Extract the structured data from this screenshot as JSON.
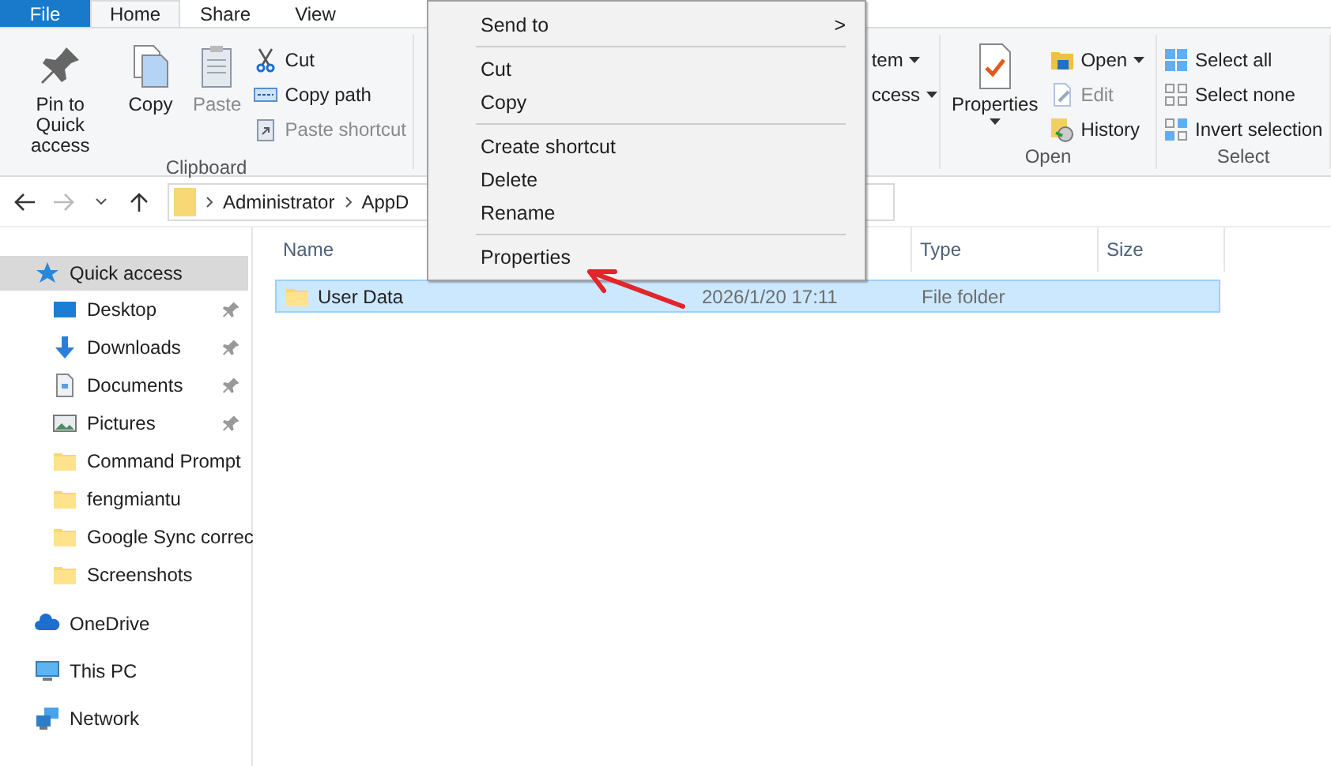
{
  "tabs": [
    {
      "label": "File",
      "kind": "file",
      "selected": false
    },
    {
      "label": "Home",
      "kind": "tab",
      "selected": true
    },
    {
      "label": "Share",
      "kind": "tab",
      "selected": false
    },
    {
      "label": "View",
      "kind": "tab",
      "selected": false
    }
  ],
  "ribbon": {
    "groups": [
      {
        "label": "Clipboard",
        "items": [
          {
            "label": "Pin to Quick access",
            "kind": "large",
            "disabled": false,
            "dropdown": false
          },
          {
            "label": "Copy",
            "kind": "large",
            "disabled": false,
            "dropdown": false
          },
          {
            "label": "Paste",
            "kind": "large",
            "disabled": true,
            "dropdown": false
          },
          {
            "label": "Cut",
            "kind": "small",
            "disabled": false,
            "dropdown": false
          },
          {
            "label": "Copy path",
            "kind": "small",
            "disabled": false,
            "dropdown": false
          },
          {
            "label": "Paste shortcut",
            "kind": "small",
            "disabled": true,
            "dropdown": false
          }
        ]
      },
      {
        "items": [
          {
            "label": "tem",
            "kind": "small",
            "disabled": false,
            "dropdown": true
          },
          {
            "label": "ccess",
            "kind": "small",
            "disabled": false,
            "dropdown": true
          }
        ]
      },
      {
        "label": "Open",
        "items": [
          {
            "label": "Properties",
            "kind": "large",
            "disabled": false,
            "dropdown": true
          },
          {
            "label": "Open",
            "kind": "small",
            "disabled": false,
            "dropdown": true
          },
          {
            "label": "Edit",
            "kind": "small",
            "disabled": true,
            "dropdown": false
          },
          {
            "label": "History",
            "kind": "small",
            "disabled": false,
            "dropdown": false
          }
        ]
      },
      {
        "label": "Select",
        "items": [
          {
            "label": "Select all",
            "kind": "small",
            "disabled": false,
            "dropdown": false
          },
          {
            "label": "Select none",
            "kind": "small",
            "disabled": false,
            "dropdown": false
          },
          {
            "label": "Invert selection",
            "kind": "small",
            "disabled": false,
            "dropdown": false
          }
        ]
      }
    ]
  },
  "navigation": {
    "back_disabled": false,
    "forward_disabled": true,
    "path": [
      "Administrator",
      "AppD"
    ]
  },
  "sidebar": {
    "items": [
      {
        "label": "Quick access",
        "kind": "root",
        "selected": true,
        "pinned": false
      },
      {
        "label": "Desktop",
        "kind": "child",
        "selected": false,
        "pinned": true
      },
      {
        "label": "Downloads",
        "kind": "child",
        "selected": false,
        "pinned": true
      },
      {
        "label": "Documents",
        "kind": "child",
        "selected": false,
        "pinned": true
      },
      {
        "label": "Pictures",
        "kind": "child",
        "selected": false,
        "pinned": true
      },
      {
        "label": "Command Prompt",
        "kind": "child",
        "selected": false,
        "pinned": false
      },
      {
        "label": "fengmiantu",
        "kind": "child",
        "selected": false,
        "pinned": false
      },
      {
        "label": "Google Sync correc",
        "kind": "child",
        "selected": false,
        "pinned": false
      },
      {
        "label": "Screenshots",
        "kind": "child",
        "selected": false,
        "pinned": false
      },
      {
        "label": "OneDrive",
        "kind": "root",
        "selected": false,
        "pinned": false
      },
      {
        "label": "This PC",
        "kind": "root",
        "selected": false,
        "pinned": false
      },
      {
        "label": "Network",
        "kind": "root",
        "selected": false,
        "pinned": false
      }
    ]
  },
  "files": {
    "columns": [
      "Name",
      "Type",
      "Size"
    ],
    "rows": [
      {
        "name": "User Data",
        "date": "2026/1/20 17:11",
        "type": "File folder",
        "selected": true
      }
    ]
  },
  "context_menu": {
    "items": [
      {
        "label": "Send to",
        "kind": "submenu",
        "submenu_mark": ">"
      },
      {
        "kind": "separator"
      },
      {
        "label": "Cut",
        "kind": "item"
      },
      {
        "label": "Copy",
        "kind": "item"
      },
      {
        "kind": "separator"
      },
      {
        "label": "Create shortcut",
        "kind": "item"
      },
      {
        "label": "Delete",
        "kind": "item"
      },
      {
        "label": "Rename",
        "kind": "item"
      },
      {
        "kind": "separator"
      },
      {
        "label": "Properties",
        "kind": "item"
      }
    ]
  }
}
